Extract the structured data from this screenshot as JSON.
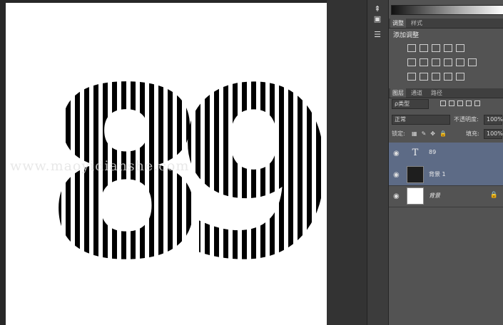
{
  "canvas": {
    "digits": "89",
    "watermark": "www.maoyidianshe.com"
  },
  "tools": [
    "tool-arrow",
    "tool-adjust",
    "tool-layers"
  ],
  "panels": {
    "tabs_top": [
      "调整",
      "样式"
    ],
    "add_adjustment_label": "添加调整",
    "tabs_layers": [
      "图层",
      "通道",
      "路径"
    ],
    "filter_kind": "ρ类型",
    "blend_mode": "正常",
    "opacity_label": "不透明度:",
    "opacity_value": "100%",
    "lock_label": "锁定:",
    "fill_label": "填充:",
    "fill_value": "100%"
  },
  "layers": [
    {
      "name": "89",
      "type": "text",
      "selected": true,
      "locked": false
    },
    {
      "name": "背景 1",
      "type": "fill",
      "selected": true,
      "locked": false
    },
    {
      "name": "背景",
      "type": "background",
      "selected": false,
      "locked": true
    }
  ],
  "colors": {
    "selection": "#5d6b86",
    "panel": "#535353"
  }
}
